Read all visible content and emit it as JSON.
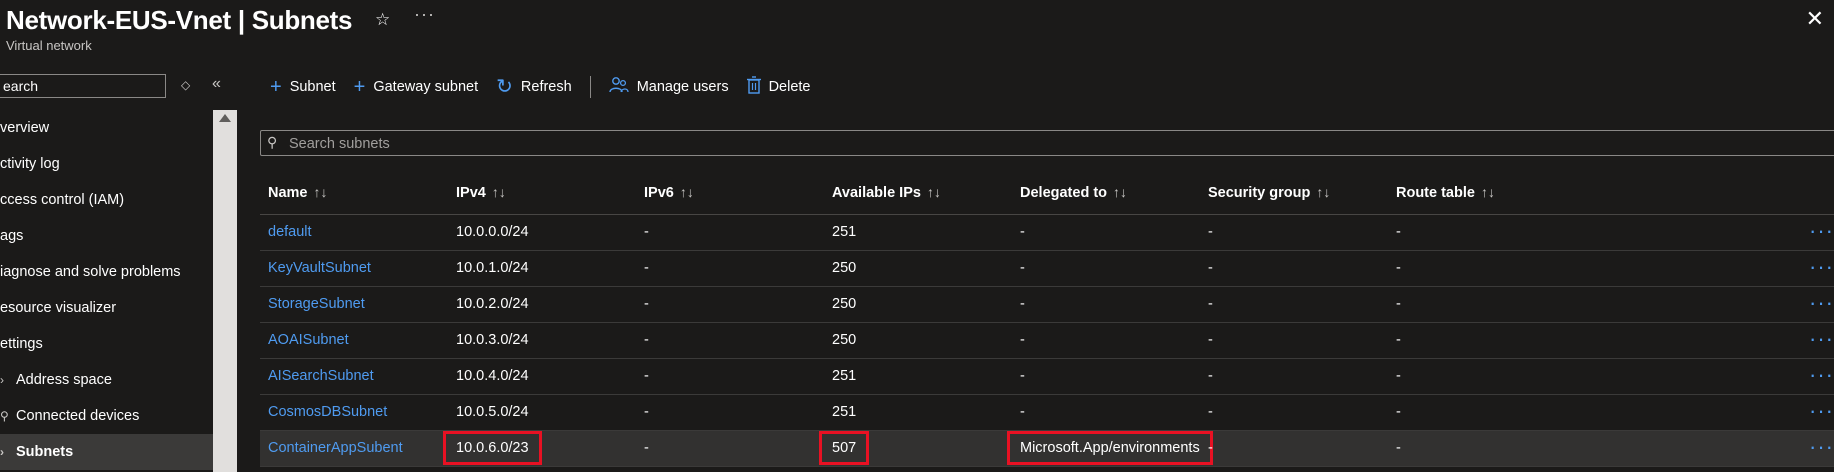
{
  "header": {
    "title": "Network-EUS-Vnet | Subnets",
    "subtitle": "Virtual network",
    "star_icon": "star-icon",
    "more_icon": "ellipsis-icon",
    "close_icon": "close-icon"
  },
  "sidebar": {
    "search_placeholder": "earch",
    "items": [
      {
        "label": "verview",
        "child": false,
        "selected": false,
        "glyph": ""
      },
      {
        "label": "ctivity log",
        "child": false,
        "selected": false,
        "glyph": ""
      },
      {
        "label": "ccess control (IAM)",
        "child": false,
        "selected": false,
        "glyph": ""
      },
      {
        "label": "ags",
        "child": false,
        "selected": false,
        "glyph": ""
      },
      {
        "label": "iagnose and solve problems",
        "child": false,
        "selected": false,
        "glyph": ""
      },
      {
        "label": "esource visualizer",
        "child": false,
        "selected": false,
        "glyph": ""
      },
      {
        "label": "ettings",
        "child": false,
        "selected": false,
        "glyph": ""
      },
      {
        "label": "Address space",
        "child": true,
        "selected": false,
        "glyph": "›"
      },
      {
        "label": "Connected devices",
        "child": true,
        "selected": false,
        "glyph": "⚲"
      },
      {
        "label": "Subnets",
        "child": true,
        "selected": true,
        "glyph": "›"
      }
    ]
  },
  "toolbar": {
    "subnet_label": "Subnet",
    "gateway_label": "Gateway subnet",
    "refresh_label": "Refresh",
    "manage_users_label": "Manage users",
    "delete_label": "Delete"
  },
  "search": {
    "placeholder": "Search subnets"
  },
  "table": {
    "columns": [
      "Name",
      "IPv4",
      "IPv6",
      "Available IPs",
      "Delegated to",
      "Security group",
      "Route table"
    ],
    "rows": [
      {
        "name": "default",
        "ipv4": "10.0.0.0/24",
        "ipv6": "-",
        "available": "251",
        "delegated": "-",
        "nsg": "-",
        "route": "-"
      },
      {
        "name": "KeyVaultSubnet",
        "ipv4": "10.0.1.0/24",
        "ipv6": "-",
        "available": "250",
        "delegated": "-",
        "nsg": "-",
        "route": "-"
      },
      {
        "name": "StorageSubnet",
        "ipv4": "10.0.2.0/24",
        "ipv6": "-",
        "available": "250",
        "delegated": "-",
        "nsg": "-",
        "route": "-"
      },
      {
        "name": "AOAISubnet",
        "ipv4": "10.0.3.0/24",
        "ipv6": "-",
        "available": "250",
        "delegated": "-",
        "nsg": "-",
        "route": "-"
      },
      {
        "name": "AISearchSubnet",
        "ipv4": "10.0.4.0/24",
        "ipv6": "-",
        "available": "251",
        "delegated": "-",
        "nsg": "-",
        "route": "-"
      },
      {
        "name": "CosmosDBSubnet",
        "ipv4": "10.0.5.0/24",
        "ipv6": "-",
        "available": "251",
        "delegated": "-",
        "nsg": "-",
        "route": "-"
      },
      {
        "name": "ContainerAppSubent",
        "ipv4": "10.0.6.0/23",
        "ipv6": "-",
        "available": "507",
        "delegated": "Microsoft.App/environments",
        "nsg": "-",
        "route": "-",
        "selected": true
      }
    ]
  },
  "colors": {
    "background": "#1b1a19",
    "link": "#4f9bf0",
    "highlight": "#e81123"
  }
}
